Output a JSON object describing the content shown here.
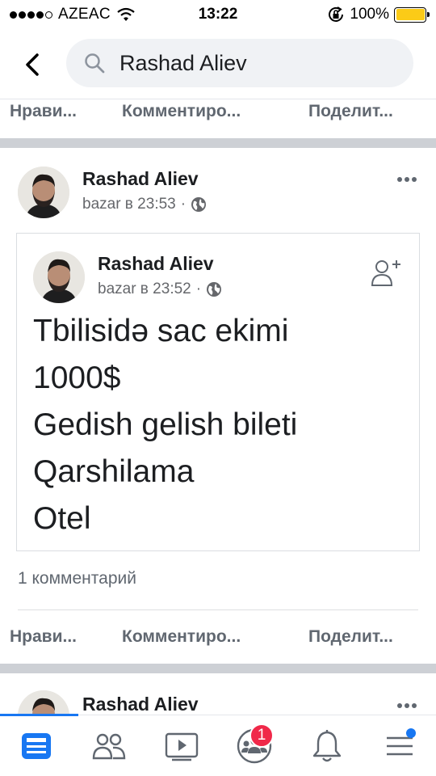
{
  "status_bar": {
    "carrier": "AZEAC",
    "time": "13:22",
    "battery": "100%",
    "battery_level": 1.0
  },
  "header": {
    "search_value": "Rashad Aliev",
    "icons": {
      "back": "back-chevron-icon",
      "search": "search-icon"
    }
  },
  "actions_top": {
    "like": "Нрави...",
    "comment": "Комментиро...",
    "share": "Поделит..."
  },
  "post": {
    "author": "Rashad Aliev",
    "time": "bazar в 23:53",
    "separator": "·",
    "privacy_icon": "globe-icon",
    "shared": {
      "author": "Rashad Aliev",
      "time": "bazar в 23:52",
      "separator": "·",
      "lines": [
        "Tbilisidə sac ekimi",
        "1000$",
        "Gedish gelish bileti",
        "Qarshilama",
        "Otel"
      ],
      "add_friend_icon": "add-friend-icon"
    },
    "comments": "1 комментарий"
  },
  "actions_bottom": {
    "like": "Нрави...",
    "comment": "Комментиро...",
    "share": "Поделит..."
  },
  "next_post": {
    "author": "Rashad Aliev"
  },
  "tab_bar": {
    "items": [
      "news-feed-icon",
      "friends-icon",
      "watch-icon",
      "groups-icon",
      "notifications-icon",
      "menu-icon"
    ],
    "groups_badge": "1",
    "active_color": "#1877f2"
  }
}
